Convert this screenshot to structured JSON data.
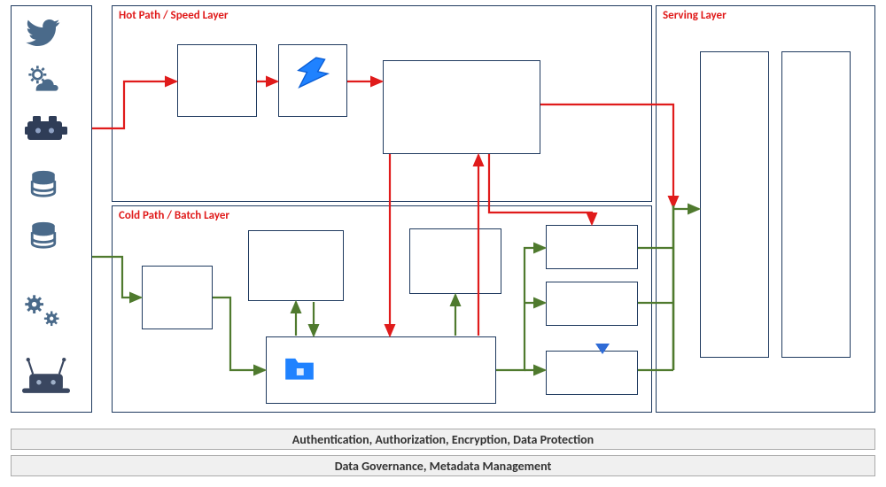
{
  "layers": {
    "sources_title": "",
    "hot_title": "Hot Path / Speed Layer",
    "cold_title": "Cold Path / Batch Layer",
    "serving_title": "Serving Layer"
  },
  "footers": {
    "security": "Authentication, Authorization, Encryption, Data Protection",
    "governance": "Data Governance, Metadata Management"
  },
  "colors": {
    "hot": "#e01b1b",
    "cold": "#4f7a2e",
    "border": "#1f3a5f",
    "azure": "#1f82ff",
    "blue_tri": "#2f6bd6",
    "icon": "#4a6a8a"
  },
  "icons": [
    "twitter",
    "weather",
    "engine",
    "database",
    "database",
    "gears",
    "iot-device"
  ]
}
